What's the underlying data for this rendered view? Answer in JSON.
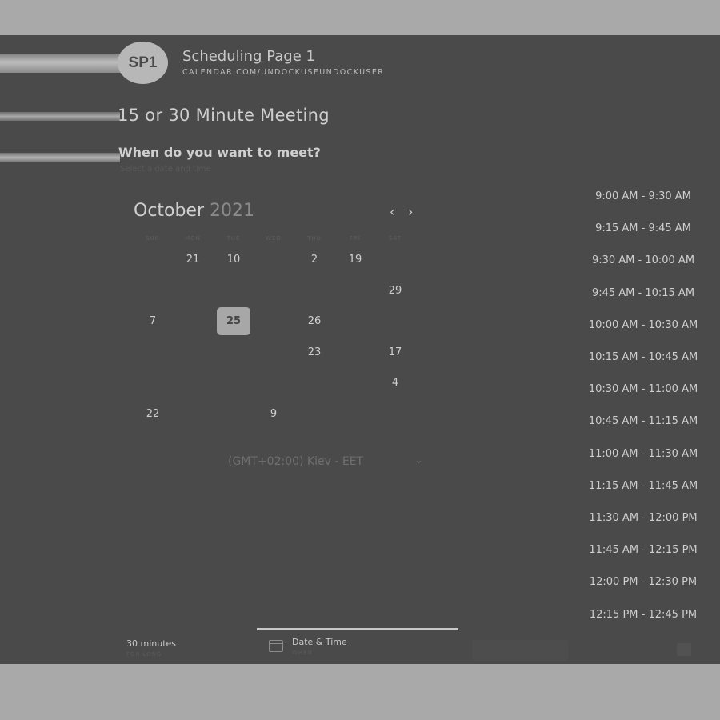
{
  "header": {
    "avatar_initials": "SP1",
    "page_name": "Scheduling Page 1",
    "page_url": "CALENDAR.COM/UNDOCKUSEUNDOCKUSER"
  },
  "meeting": {
    "title": "15 or 30 Minute Meeting",
    "question": "When do you want to meet?",
    "instruction": "Select a date and time"
  },
  "calendar": {
    "month": "October",
    "year": "2021",
    "weekdays": [
      "SUN",
      "MON",
      "TUE",
      "WED",
      "THU",
      "FRI",
      "SAT"
    ],
    "weeks": [
      [
        "",
        "21",
        "10",
        "",
        "2",
        "19",
        ""
      ],
      [
        "",
        "",
        "",
        "",
        "",
        "",
        "29"
      ],
      [
        "7",
        "",
        "25",
        "",
        "26",
        "",
        ""
      ],
      [
        "",
        "",
        "",
        "",
        "23",
        "",
        "17"
      ],
      [
        "",
        "",
        "",
        "",
        "",
        "",
        "4"
      ],
      [
        "22",
        "",
        "",
        "9",
        "",
        "",
        ""
      ]
    ],
    "selected_day": "25"
  },
  "timezone": "(GMT+02:00) Kiev - EET",
  "time_slots": [
    "9:00 AM - 9:30 AM",
    "9:15 AM - 9:45 AM",
    "9:30 AM - 10:00 AM",
    "9:45 AM - 10:15 AM",
    "10:00 AM - 10:30 AM",
    "10:15 AM - 10:45 AM",
    "10:30 AM - 11:00 AM",
    "10:45 AM - 11:15 AM",
    "11:00 AM - 11:30 AM",
    "11:15 AM - 11:45 AM",
    "11:30 AM - 12:00 PM",
    "11:45 AM - 12:15 PM",
    "12:00 PM - 12:30 PM",
    "12:15 PM - 12:45 PM"
  ],
  "footer": {
    "duration": "30 minutes",
    "duration_sub": "FOR LONG",
    "tab_label": "Date & Time",
    "tab_sub": "WHEN"
  }
}
